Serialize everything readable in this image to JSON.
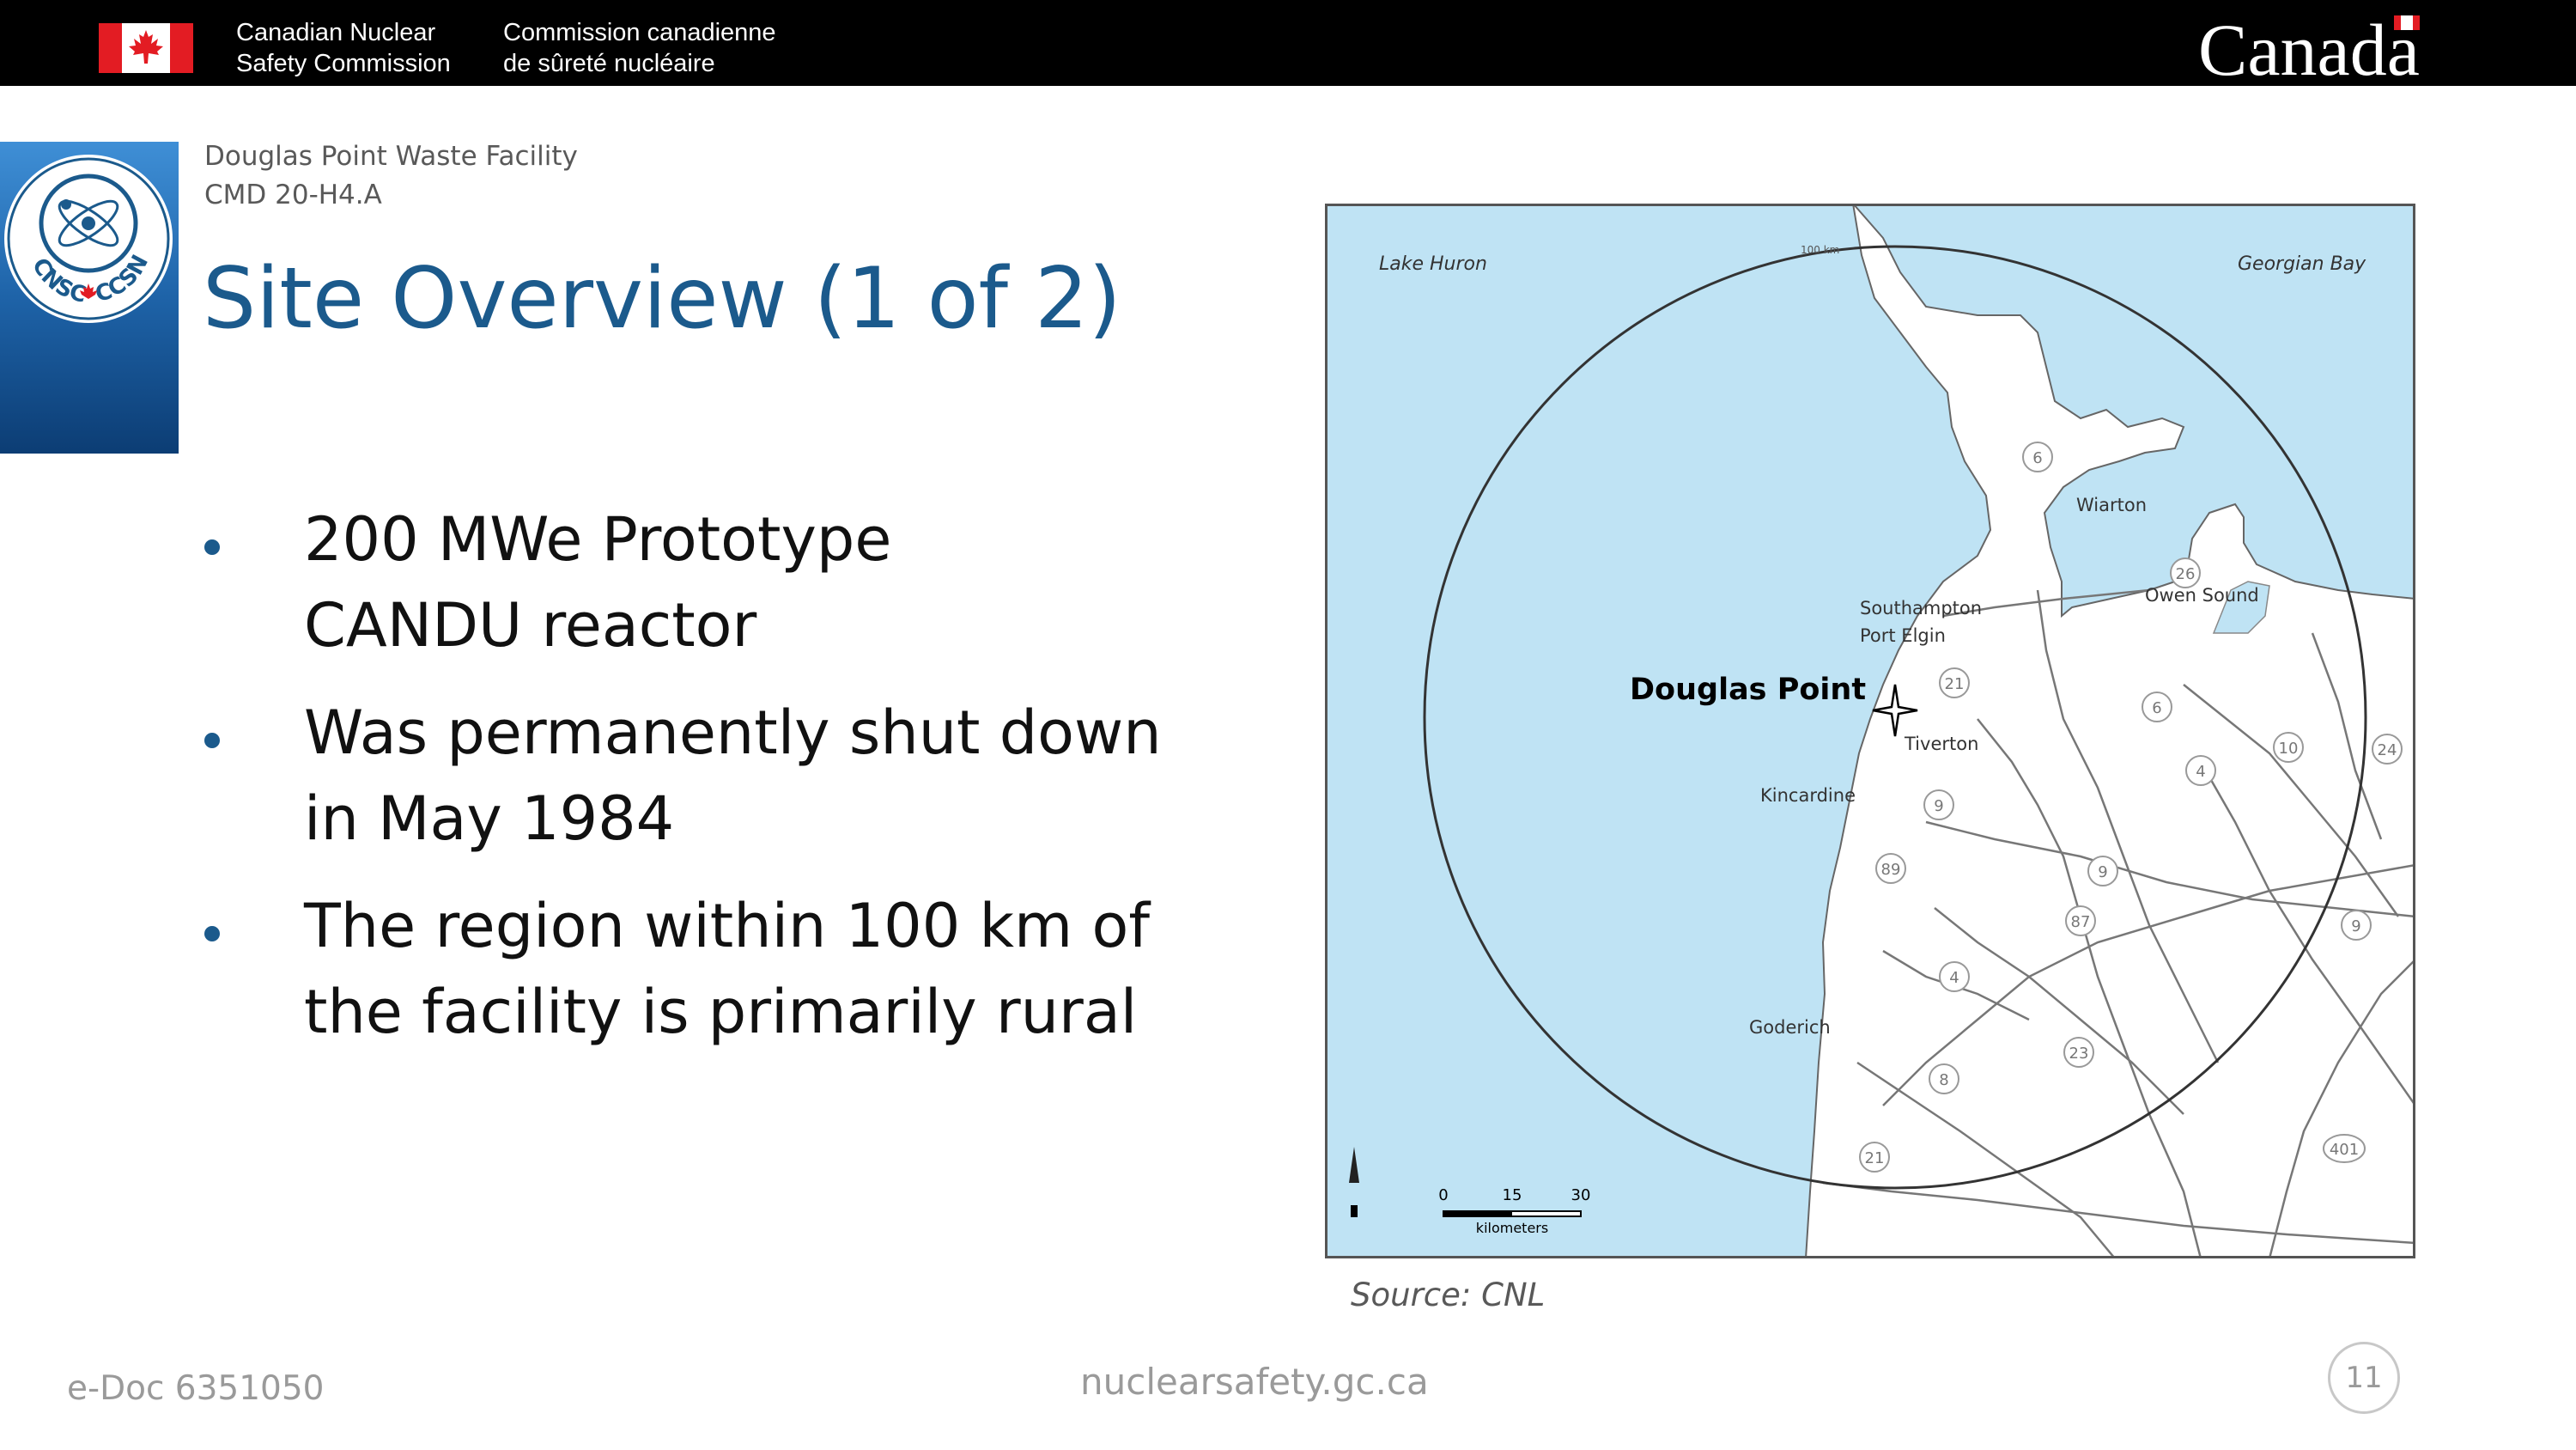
{
  "banner": {
    "org_en": [
      "Canadian Nuclear",
      "Safety Commission"
    ],
    "org_fr": [
      "Commission canadienne",
      "de sûreté nucléaire"
    ],
    "wordmark": "Canada"
  },
  "header": {
    "facility": "Douglas Point Waste Facility",
    "cmd": "CMD 20-H4.A",
    "title": "Site Overview (1 of 2)",
    "logo_text_left": "CNSC",
    "logo_text_right": "CCSN"
  },
  "bullets": [
    {
      "lines": [
        "200 MWe Prototype",
        "CANDU reactor"
      ]
    },
    {
      "lines": [
        "Was permanently shut down",
        "in May 1984"
      ]
    },
    {
      "lines": [
        "The region within 100 km of",
        "the facility is primarily rural"
      ]
    }
  ],
  "map": {
    "water_labels": [
      "Lake Huron",
      "Georgian Bay"
    ],
    "site_label": "Douglas Point",
    "towns": [
      "Wiarton",
      "Owen Sound",
      "Southampton",
      "Port Elgin",
      "Tiverton",
      "Kincardine",
      "Goderich"
    ],
    "radius_label": "100 km",
    "scale_ticks": [
      "0",
      "15",
      "30"
    ],
    "scale_unit": "kilometers",
    "route_numbers": [
      "6",
      "21",
      "9",
      "4",
      "10",
      "24",
      "89",
      "87",
      "23",
      "8",
      "401",
      "26"
    ],
    "colors": {
      "water": "#bfe3f4",
      "land": "#ffffff",
      "roads": "#777777",
      "border": "#555555"
    }
  },
  "source": "Source: CNL",
  "footer": {
    "edoc": "e-Doc 6351050",
    "url": "nuclearsafety.gc.ca",
    "page": "11"
  },
  "colors": {
    "title": "#1b5a8c",
    "banner": "#000000",
    "flag_red": "#e31c23",
    "footer_gray": "#9a9a9a"
  }
}
